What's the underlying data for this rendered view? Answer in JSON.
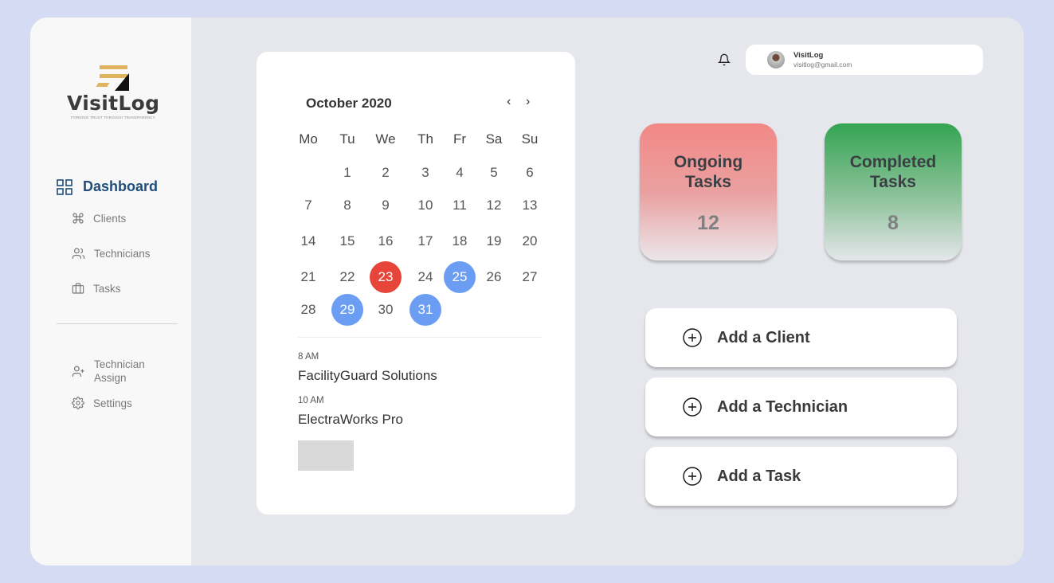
{
  "brand": {
    "name": "VisitLog",
    "tagline": "FORGING TRUST THROUGH TRANSPARENCY",
    "logo_colors": {
      "bars": "#e0b35e",
      "triangle": "#111111"
    }
  },
  "sidebar": {
    "main_item": {
      "label": "Dashboard",
      "icon": "grid-icon"
    },
    "items": [
      {
        "label": "Clients",
        "icon": "command-icon"
      },
      {
        "label": "Technicians",
        "icon": "users-icon"
      },
      {
        "label": "Tasks",
        "icon": "briefcase-icon"
      }
    ],
    "bottom_items": [
      {
        "label": "Technician Assign",
        "icon": "user-plus-icon"
      },
      {
        "label": "Settings",
        "icon": "gear-icon"
      }
    ]
  },
  "header": {
    "notification_icon": "bell-icon",
    "user": {
      "name": "VisitLog",
      "email": "visitlog@gmail.com"
    }
  },
  "calendar": {
    "month_label": "October 2020",
    "prev_icon": "chevron-left-icon",
    "next_icon": "chevron-right-icon",
    "weekdays": [
      "Mo",
      "Tu",
      "We",
      "Th",
      "Fr",
      "Sa",
      "Su"
    ],
    "weeks": [
      [
        "",
        "1",
        "2",
        "3",
        "4",
        "5",
        "6"
      ],
      [
        "7",
        "8",
        "9",
        "10",
        "11",
        "12",
        "13"
      ],
      [
        "14",
        "15",
        "16",
        "17",
        "18",
        "19",
        "20"
      ],
      [
        "21",
        "22",
        "23",
        "24",
        "25",
        "26",
        "27"
      ],
      [
        "28",
        "29",
        "30",
        "31",
        "",
        "",
        ""
      ]
    ],
    "highlighted": {
      "23": "red",
      "25": "blue",
      "29": "blue",
      "31": "blue"
    },
    "highlight_colors": {
      "red": "#e8453a",
      "blue": "#6b9ef3"
    },
    "events": [
      {
        "time": "8 AM",
        "name": "FacilityGuard Solutions"
      },
      {
        "time": "10 AM",
        "name": "ElectraWorks Pro"
      }
    ]
  },
  "stats": [
    {
      "title_line1": "Ongoing",
      "title_line2": "Tasks",
      "value": "12",
      "color": "#f28886"
    },
    {
      "title_line1": "Completed",
      "title_line2": "Tasks",
      "value": "8",
      "color": "#34a452"
    }
  ],
  "actions": [
    {
      "label": "Add a Client",
      "icon": "plus-circle-icon"
    },
    {
      "label": "Add a Technician",
      "icon": "plus-circle-icon"
    },
    {
      "label": "Add a Task",
      "icon": "plus-circle-icon"
    }
  ]
}
